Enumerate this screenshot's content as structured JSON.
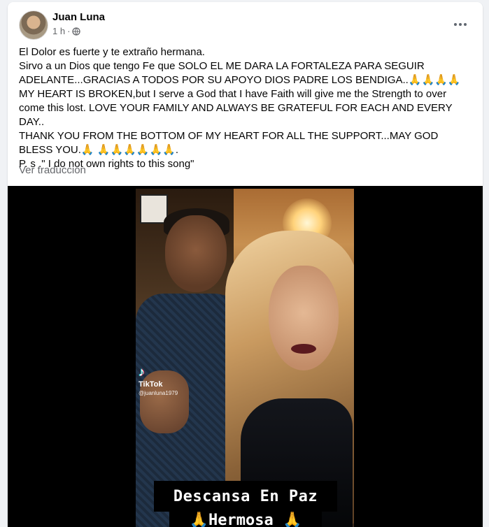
{
  "post": {
    "author": "Juan Luna",
    "time": "1 h",
    "separator": "·",
    "text_lines": [
      "El Dolor es fuerte y te extraño hermana.",
      "Sirvo a un Dios que tengo Fe que SOLO EL ME DARA LA FORTALEZA PARA SEGUIR ADELANTE...GRACIAS A TODOS POR SU APOYO DIOS PADRE LOS BENDIGA..🙏🙏🙏🙏",
      "MY HEART IS BROKEN,but I serve a God that I have Faith will give me the Strength to over come this lost. LOVE YOUR FAMILY AND ALWAYS BE GRATEFUL FOR EACH AND EVERY DAY..",
      "THANK YOU FROM THE BOTTOM OF MY HEART FOR ALL THE SUPPORT...MAY GOD BLESS YOU.🙏 🙏🙏🙏🙏🙏🙏.",
      "P. s .\" I do not own rights to this song\""
    ],
    "translate_label": "Ver traducción"
  },
  "media": {
    "watermark_name": "TikTok",
    "watermark_user": "@juanluna1979",
    "caption_line1": "Descansa En Paz",
    "caption_line2": "🙏Hermosa 🙏"
  },
  "icons": {
    "privacy": "globe-icon",
    "more": "more-horizontal-icon",
    "avatar": "profile-photo"
  }
}
